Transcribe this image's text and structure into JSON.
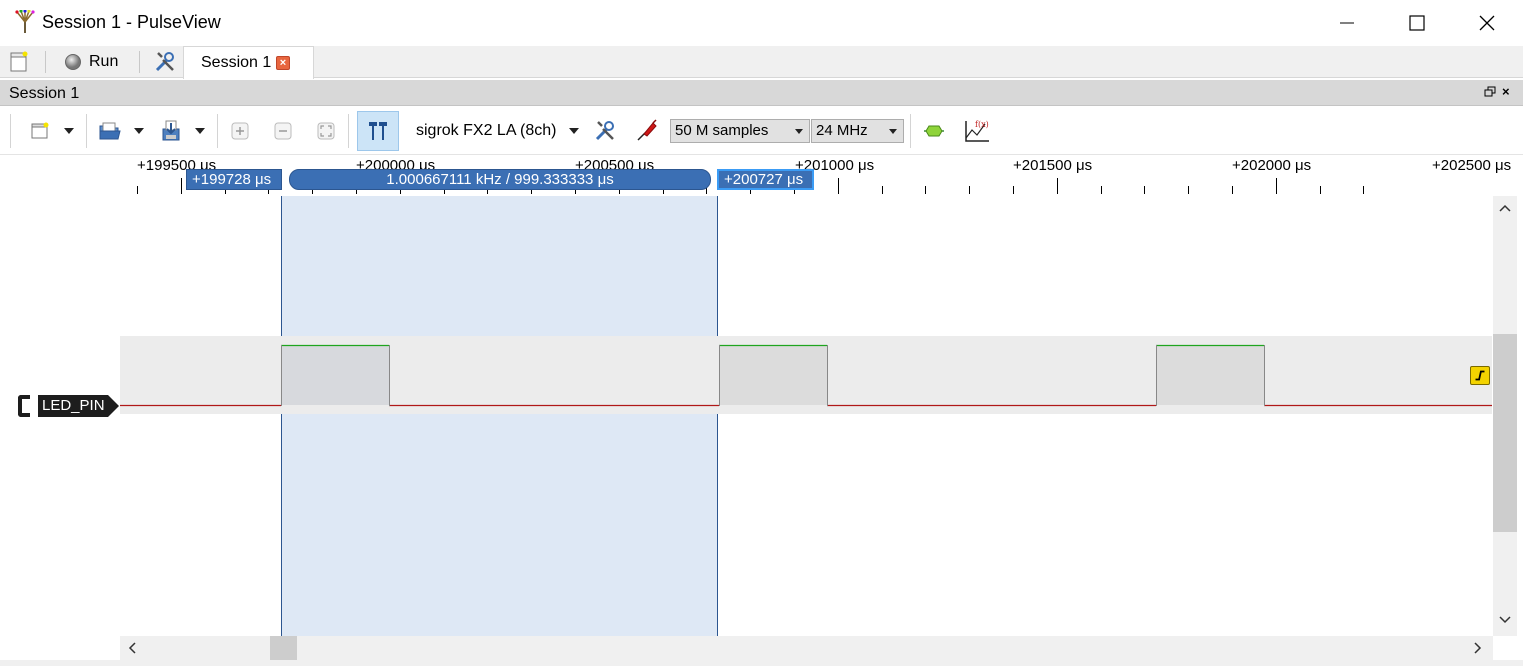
{
  "window": {
    "title": "Session 1 - PulseView"
  },
  "tabrow": {
    "run_label": "Run",
    "session_tab_label": "Session 1",
    "session_tab_close": "×"
  },
  "session_header": {
    "label": "Session 1",
    "close": "×"
  },
  "toolbar": {
    "device_label": "sigrok FX2 LA (8ch)",
    "samples_value": "50 M samples",
    "samplerate_value": "24 MHz"
  },
  "ruler": {
    "labels": [
      "+199500 μs",
      "+200000 μs",
      "+200500 μs",
      "+201000 μs",
      "+201500 μs",
      "+202000 μs",
      "+202500 μs"
    ]
  },
  "cursors": {
    "left_flag": "+199728 μs",
    "right_flag": "+200727 μs",
    "measurement": "1.000667111 kHz / 999.333333 μs"
  },
  "channel": {
    "name": "LED_PIN"
  },
  "colors": {
    "high_edge": "#1fa51f",
    "low_line": "#b01818",
    "cursor_flag": "#3b6fb4",
    "trigger": "#f3d300"
  }
}
